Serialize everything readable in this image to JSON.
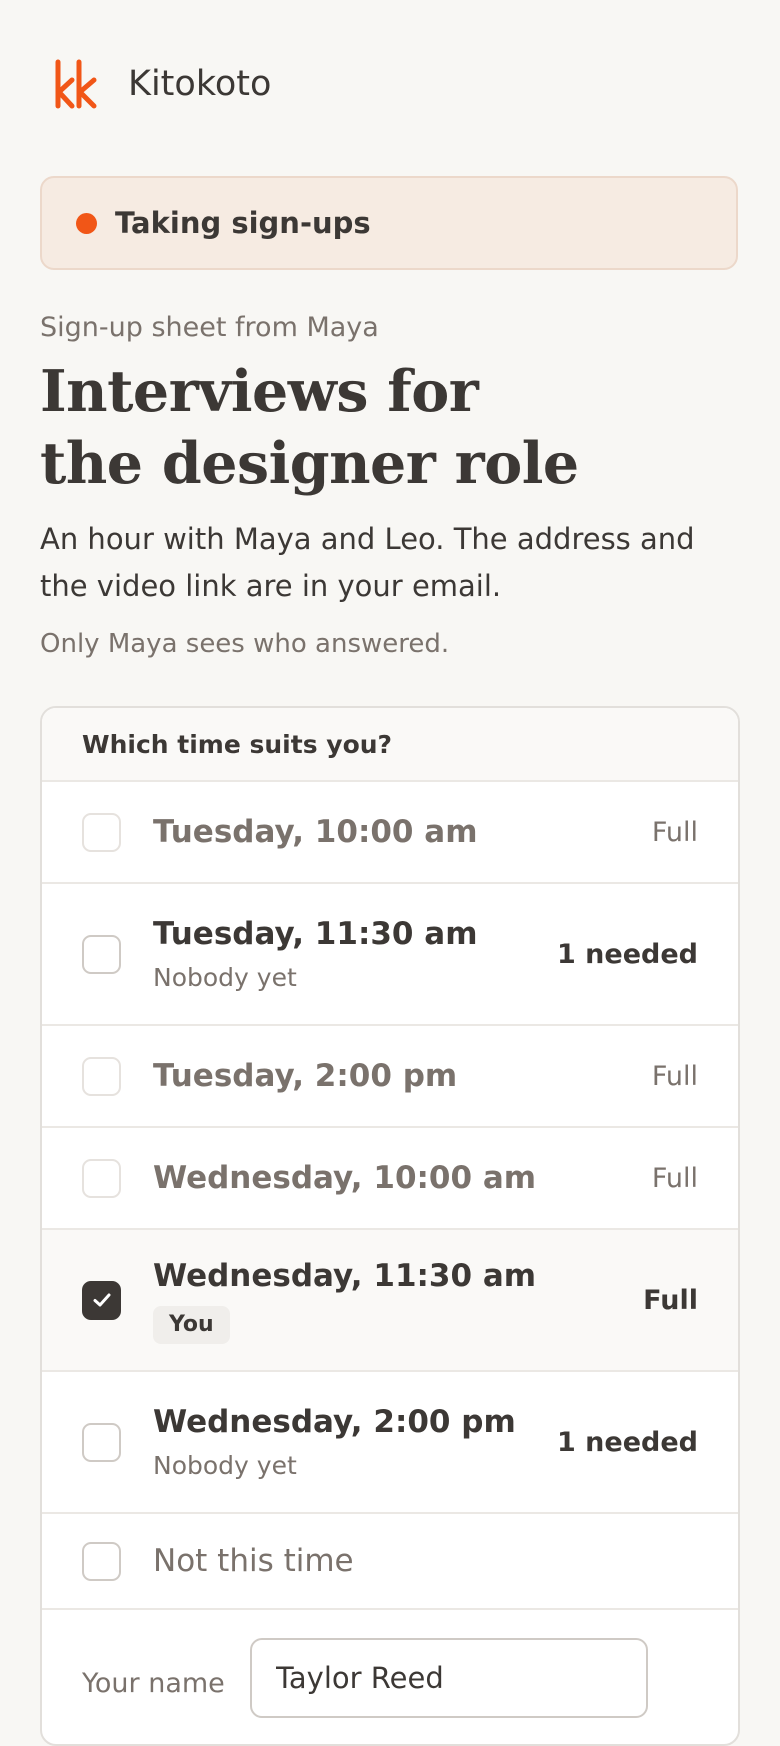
{
  "app": {
    "name": "Kitokoto"
  },
  "banner": {
    "label": "Taking sign-ups",
    "dot_color": "#f15617"
  },
  "intro": {
    "from": "Sign-up sheet from Maya",
    "title_line1": "Interviews for",
    "title_line2": "the designer role",
    "description": "An hour with Maya and Leo. The address and the video link are in your email.",
    "privacy": "Only Maya sees who answered."
  },
  "question": {
    "label": "Which time suits you?",
    "slots": [
      {
        "time": "Tuesday, 10:00 am",
        "status": "Full"
      },
      {
        "time": "Tuesday, 11:30 am",
        "sub": "Nobody yet",
        "status": "1 needed"
      },
      {
        "time": "Tuesday, 2:00 pm",
        "status": "Full"
      },
      {
        "time": "Wednesday, 10:00 am",
        "status": "Full"
      },
      {
        "time": "Wednesday, 11:30 am",
        "badge": "You",
        "status": "Full",
        "checked": true
      },
      {
        "time": "Wednesday, 2:00 pm",
        "sub": "Nobody yet",
        "status": "1 needed"
      }
    ],
    "opt_out": "Not this time"
  },
  "name_field": {
    "label": "Your name",
    "value": "Taylor Reed"
  },
  "colors": {
    "accent": "#f15617",
    "text": "#3c3835",
    "muted": "#7a726c",
    "background": "#f8f7f4"
  }
}
